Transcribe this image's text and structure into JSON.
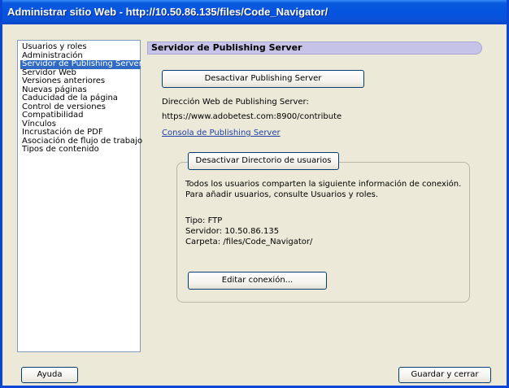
{
  "window": {
    "title": "Administrar sitio Web - http://10.50.86.135/files/Code_Navigator/"
  },
  "sidebar": {
    "items": [
      {
        "label": "Usuarios y roles"
      },
      {
        "label": "Administración"
      },
      {
        "label": "Servidor de Publishing Server",
        "selected": true
      },
      {
        "label": "Servidor Web"
      },
      {
        "label": "Versiones anteriores"
      },
      {
        "label": "Nuevas páginas"
      },
      {
        "label": "Caducidad de la página"
      },
      {
        "label": "Control de versiones"
      },
      {
        "label": "Compatibilidad"
      },
      {
        "label": "Vínculos"
      },
      {
        "label": "Incrustación de PDF"
      },
      {
        "label": "Asociación de flujo de trabajo"
      },
      {
        "label": "Tipos de contenido"
      }
    ]
  },
  "panel": {
    "header": "Servidor de Publishing Server",
    "deactivate_button": "Desactivar Publishing Server",
    "address_label": "Dirección Web de Publishing Server:",
    "address_value": "https://www.adobetest.com:8900/contribute",
    "console_link": "Consola de Publishing Server",
    "directory": {
      "button": "Desactivar Directorio de usuarios",
      "info_line1": "Todos los usuarios comparten la siguiente información de conexión.",
      "info_line2": "Para añadir usuarios, consulte Usuarios y roles.",
      "type": "Tipo: FTP",
      "server": "Servidor: 10.50.86.135",
      "folder": "Carpeta: /files/Code_Navigator/",
      "edit_button": "Editar conexión..."
    }
  },
  "footer": {
    "help_button": "Ayuda",
    "save_close_button": "Guardar y cerrar"
  },
  "colors": {
    "titlebar": "#0554e0",
    "selection": "#316ac5",
    "header_bar": "#c6c3e8",
    "link": "#1f3fa6"
  }
}
